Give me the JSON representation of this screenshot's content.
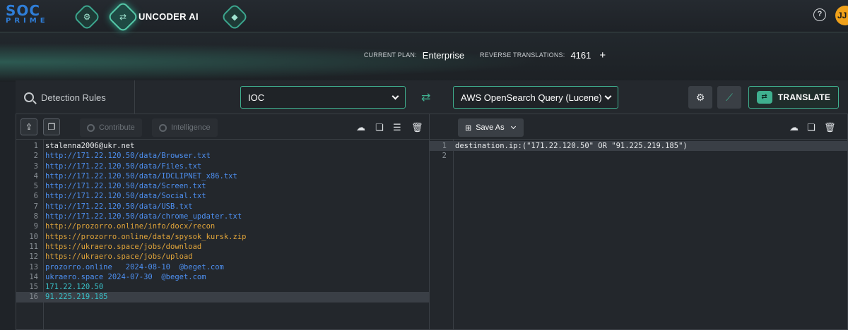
{
  "header": {
    "logo_line1": "SOC",
    "logo_line2": "PRIME",
    "nav_title": "UNCODER AI",
    "avatar_initials": "JJ",
    "help": "?"
  },
  "plan": {
    "current_plan_label": "CURRENT PLAN:",
    "current_plan_value": "Enterprise",
    "reverse_label": "REVERSE TRANSLATIONS:",
    "reverse_value": "4161",
    "plus": "+"
  },
  "toolbar": {
    "search_label": "Detection Rules",
    "source_select": "IOC",
    "target_select": "AWS OpenSearch Query (Lucene)",
    "translate_label": "TRANSLATE"
  },
  "left_editor": {
    "contribute_label": "Contribute",
    "intelligence_label": "Intelligence",
    "lines": [
      "stalenna2006@ukr.net",
      "http://171.22.120.50/data/Browser.txt",
      "http://171.22.120.50/data/Files.txt",
      "http://171.22.120.50/data/IDCLIPNET_x86.txt",
      "http://171.22.120.50/data/Screen.txt",
      "http://171.22.120.50/data/Social.txt",
      "http://171.22.120.50/data/USB.txt",
      "http://171.22.120.50/data/chrome_updater.txt",
      "http://prozorro.online/info/docx/recon",
      "https://prozorro.online/data/spysok_kursk.zip",
      "https://ukraero.space/jobs/download",
      "https://ukraero.space/jobs/upload",
      "prozorro.online   2024-08-10  @beget.com",
      "ukraero.space 2024-07-30  @beget.com",
      "171.22.120.50",
      "91.225.219.185"
    ]
  },
  "right_editor": {
    "save_as_label": "Save As",
    "lines": [
      "destination.ip:(\"171.22.120.50\" OR \"91.225.219.185\")",
      ""
    ]
  },
  "colors": {
    "accent": "#3fb08f",
    "brand_blue": "#2f7ed8",
    "avatar": "#f0a11a",
    "code_blue": "#4d8ff0",
    "code_orange": "#e0a43a",
    "code_teal": "#39c0c8"
  }
}
